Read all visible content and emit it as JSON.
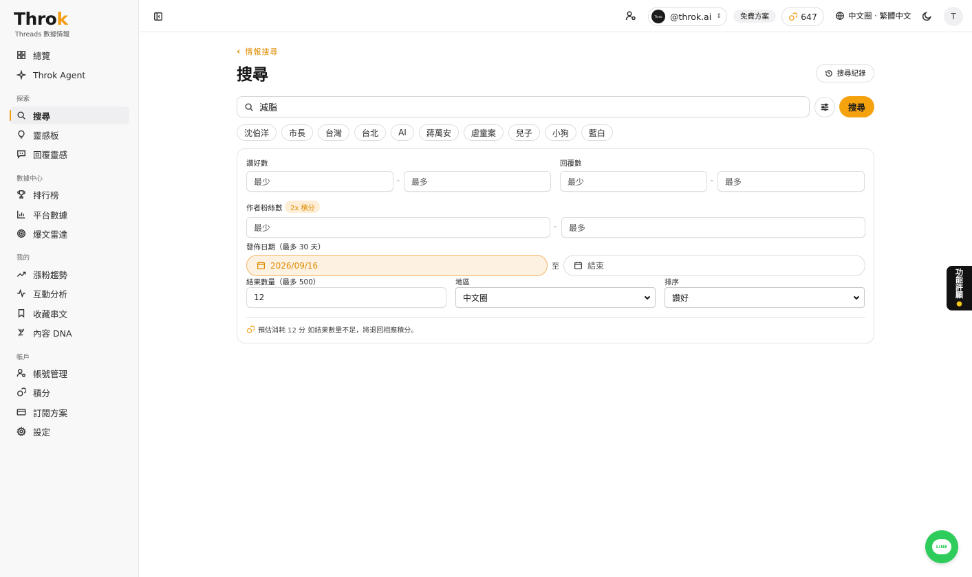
{
  "brand": {
    "name_main": "Thro",
    "name_accent": "k",
    "subtitle": "Threads 數據情報"
  },
  "sidebar": {
    "top_items": [
      {
        "label": "總覽",
        "icon": "grid-icon"
      },
      {
        "label": "Throk Agent",
        "icon": "sparkle-icon"
      }
    ],
    "sections": [
      {
        "title": "探索",
        "items": [
          {
            "label": "搜尋",
            "icon": "search-icon",
            "active": true
          },
          {
            "label": "靈感板",
            "icon": "lightbulb-icon"
          },
          {
            "label": "回覆靈感",
            "icon": "reply-icon"
          }
        ]
      },
      {
        "title": "數據中心",
        "items": [
          {
            "label": "排行榜",
            "icon": "trophy-icon"
          },
          {
            "label": "平台數據",
            "icon": "bar-chart-icon"
          },
          {
            "label": "爆文雷達",
            "icon": "radar-icon"
          }
        ]
      },
      {
        "title": "我的",
        "items": [
          {
            "label": "漲粉趨勢",
            "icon": "trend-up-icon"
          },
          {
            "label": "互動分析",
            "icon": "activity-icon"
          },
          {
            "label": "收藏串文",
            "icon": "bookmark-icon"
          },
          {
            "label": "內容 DNA",
            "icon": "dna-icon"
          }
        ]
      },
      {
        "title": "帳戶",
        "items": [
          {
            "label": "帳號管理",
            "icon": "user-cog-icon"
          },
          {
            "label": "積分",
            "icon": "coins-icon"
          },
          {
            "label": "訂閱方案",
            "icon": "credit-card-icon"
          },
          {
            "label": "設定",
            "icon": "gear-icon"
          }
        ]
      }
    ]
  },
  "header": {
    "account_handle": "@throk.ai",
    "account_logo_text": "Throk",
    "plan": "免費方案",
    "credits": "647",
    "region_language": "中文圈 · 繁體中文",
    "user_initial": "T"
  },
  "main": {
    "back_link": "情報搜尋",
    "title": "搜尋",
    "history_button": "搜尋紀錄",
    "search_value": "減脂",
    "search_button": "搜尋",
    "chips": [
      "沈伯洋",
      "市長",
      "台灣",
      "台北",
      "AI",
      "蔣萬安",
      "虐童案",
      "兒子",
      "小狗",
      "藍白"
    ],
    "filters": {
      "likes_label": "讚好數",
      "replies_label": "回覆數",
      "followers_label": "作者粉絲數",
      "followers_bonus": "2x 積分",
      "min_placeholder": "最少",
      "max_placeholder": "最多",
      "range_sep": "-",
      "date_label": "發佈日期（最多 30 天）",
      "date_start": "2026/09/16",
      "date_to": "至",
      "date_end_placeholder": "結束",
      "result_count_label": "結果數量（最多 500）",
      "result_count_value": "12",
      "region_label": "地區",
      "region_value": "中文圈",
      "sort_label": "排序",
      "sort_value": "讚好"
    },
    "estimate_text": "預估消耗 12 分 如結果數量不足，將退回相應積分。"
  },
  "side_tab": {
    "line1": "功",
    "line2": "能",
    "line3": "許",
    "line4": "願"
  },
  "line_button": {
    "label": "LINE"
  },
  "colors": {
    "accent": "#f5a20f",
    "accent_text": "#e08b00",
    "line_green": "#2ecc5b"
  }
}
